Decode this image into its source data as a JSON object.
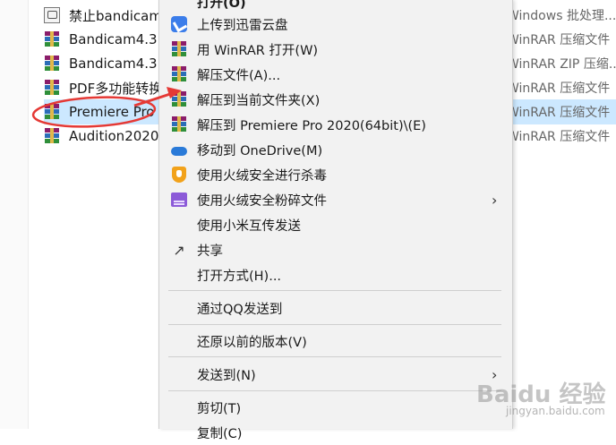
{
  "files": [
    {
      "name": "禁止bandicam",
      "icon": "batch-file-icon",
      "type": "Windows 批处理..."
    },
    {
      "name": "Bandicam4.3",
      "icon": "winrar-icon",
      "type": "WinRAR 压缩文件"
    },
    {
      "name": "Bandicam4.3",
      "icon": "winrar-icon",
      "type": "WinRAR ZIP 压缩..."
    },
    {
      "name": "PDF多功能转换",
      "icon": "winrar-icon",
      "type": "WinRAR 压缩文件"
    },
    {
      "name": "Premiere Pro",
      "icon": "winrar-icon",
      "type": "WinRAR 压缩文件"
    },
    {
      "name": "Audition2020",
      "icon": "winrar-icon",
      "type": "WinRAR 压缩文件"
    }
  ],
  "menu": {
    "open_partial": "打开(O)",
    "items": [
      {
        "label": "上传到迅雷云盘",
        "icon": "xunlei-icon"
      },
      {
        "label": "用 WinRAR 打开(W)",
        "icon": "winrar-icon"
      },
      {
        "label": "解压文件(A)...",
        "icon": "winrar-icon"
      },
      {
        "label": "解压到当前文件夹(X)",
        "icon": "winrar-icon"
      },
      {
        "label": "解压到 Premiere Pro 2020(64bit)\\(E)",
        "icon": "winrar-icon"
      },
      {
        "label": "移动到 OneDrive(M)",
        "icon": "onedrive-icon"
      },
      {
        "label": "使用火绒安全进行杀毒",
        "icon": "huorong-shield-icon"
      },
      {
        "label": "使用火绒安全粉碎文件",
        "icon": "shredder-icon"
      },
      {
        "label": "使用小米互传发送",
        "icon": ""
      },
      {
        "label": "共享",
        "icon": "share-icon"
      },
      {
        "label": "打开方式(H)...",
        "icon": ""
      },
      {
        "label": "通过QQ发送到",
        "icon": ""
      },
      {
        "label": "还原以前的版本(V)",
        "icon": ""
      },
      {
        "label": "发送到(N)",
        "icon": ""
      },
      {
        "label": "剪切(T)",
        "icon": ""
      },
      {
        "label": "复制(C)",
        "icon": ""
      }
    ]
  },
  "watermark": {
    "main": "Baidu 经验",
    "sub": "jingyan.baidu.com"
  },
  "colors": {
    "selection": "#cce8ff",
    "annotation_red": "#e53935",
    "menu_bg": "#f2f2f2"
  }
}
